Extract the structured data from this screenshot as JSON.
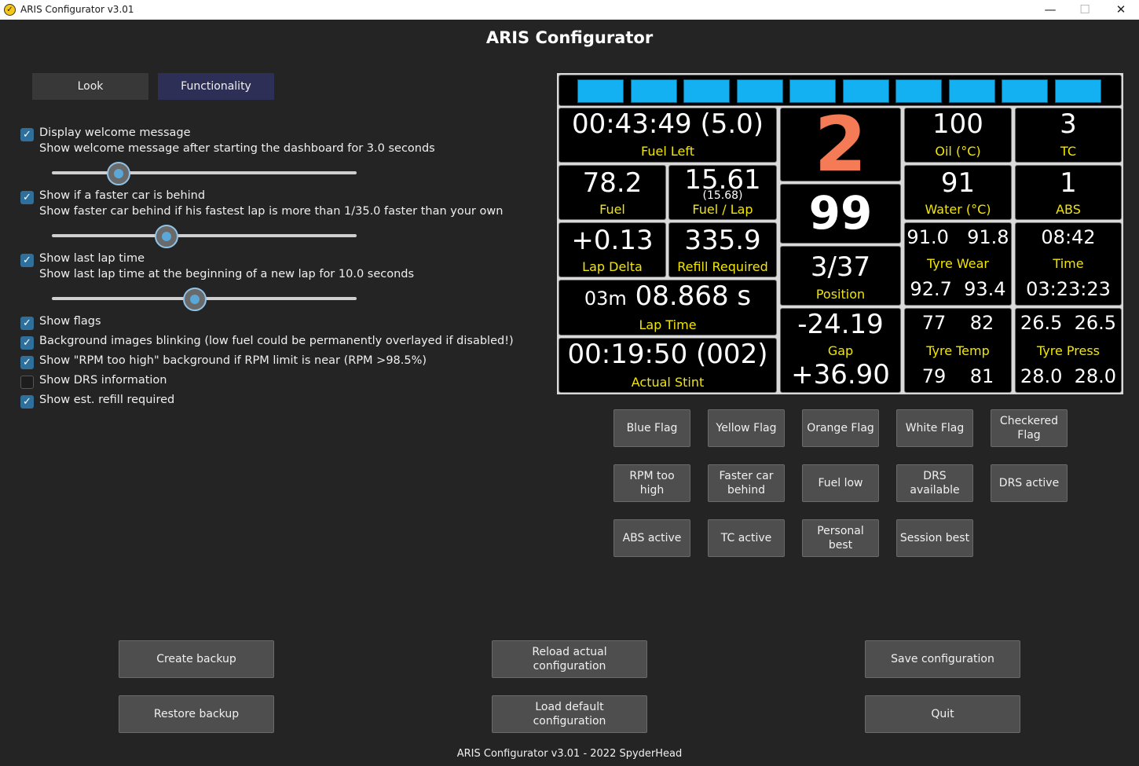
{
  "window": {
    "title": "ARIS Configurator v3.01",
    "minimize": "—",
    "maximize": "☐",
    "close": "✕"
  },
  "heading": "ARIS Configurator",
  "tabs": {
    "look": "Look",
    "functionality": "Functionality",
    "active": "Functionality"
  },
  "options": [
    {
      "label": "Display welcome message",
      "checked": true,
      "description": "Show welcome message after starting the dashboard for 3.0 seconds",
      "slider_fraction": 0.22
    },
    {
      "label": "Show if a faster car is behind",
      "checked": true,
      "description": "Show faster car behind if his fastest lap is more than 1/35.0 faster than your own",
      "slider_fraction": 0.375
    },
    {
      "label": "Show last lap time",
      "checked": true,
      "description": "Show last lap time at the beginning of a new lap for 10.0 seconds",
      "slider_fraction": 0.47
    },
    {
      "label": "Show flags",
      "checked": true
    },
    {
      "label": "Background images blinking (low fuel could be permanently overlayed if disabled!)",
      "checked": true
    },
    {
      "label": "Show \"RPM too high\" background if RPM limit is near (RPM >98.5%)",
      "checked": true
    },
    {
      "label": "Show DRS information",
      "checked": false
    },
    {
      "label": "Show est. refill required",
      "checked": true
    }
  ],
  "dashboard": {
    "led_color": "#13b1f1",
    "fuel_left": {
      "value": "00:43:49 (5.0)",
      "label": "Fuel Left"
    },
    "gear": {
      "value": "2",
      "color": "#f47b55"
    },
    "speed": "99",
    "oil": {
      "value": "100",
      "label": "Oil (°C)"
    },
    "tc": {
      "value": "3",
      "label": "TC"
    },
    "fuel": {
      "value": "78.2",
      "label": "Fuel"
    },
    "fuel_per_lap": {
      "value": "15.61",
      "sub": "(15.68)",
      "label": "Fuel / Lap"
    },
    "water": {
      "value": "91",
      "label": "Water (°C)"
    },
    "abs": {
      "value": "1",
      "label": "ABS"
    },
    "lap_delta": {
      "value": "+0.13",
      "label": "Lap Delta"
    },
    "refill": {
      "value": "335.9",
      "label": "Refill Required"
    },
    "tyre_wear": {
      "fl": "91.0",
      "fr": "91.8",
      "rl": "92.7",
      "rr": "93.4",
      "label": "Tyre Wear"
    },
    "time": {
      "clock": "08:42",
      "label": "Time",
      "elapsed": "03:23:23"
    },
    "position": {
      "value": "3/37",
      "label": "Position"
    },
    "lap_time": {
      "prefix": "03m",
      "value": "08.868 s",
      "label": "Lap Time"
    },
    "gap": {
      "ahead": "-24.19",
      "label": "Gap",
      "behind": "+36.90"
    },
    "tyre_temp": {
      "fl": "77",
      "fr": "82",
      "rl": "79",
      "rr": "81",
      "label": "Tyre Temp"
    },
    "tyre_press": {
      "fl": "26.5",
      "fr": "26.5",
      "rl": "28.0",
      "rr": "28.0",
      "label": "Tyre Press"
    },
    "actual_stint": {
      "value": "00:19:50 (002)",
      "label": "Actual Stint"
    }
  },
  "flag_buttons": [
    "Blue Flag",
    "Yellow Flag",
    "Orange Flag",
    "White Flag",
    "Checkered Flag",
    "RPM too high",
    "Faster car behind",
    "Fuel low",
    "DRS available",
    "DRS active",
    "ABS active",
    "TC active",
    "Personal best",
    "Session best"
  ],
  "bottom_buttons": {
    "create_backup": "Create backup",
    "restore_backup": "Restore backup",
    "reload_actual": "Reload actual configuration",
    "load_default": "Load default configuration",
    "save_config": "Save configuration",
    "quit": "Quit"
  },
  "footer": "ARIS Configurator v3.01 - 2022 SpyderHead"
}
